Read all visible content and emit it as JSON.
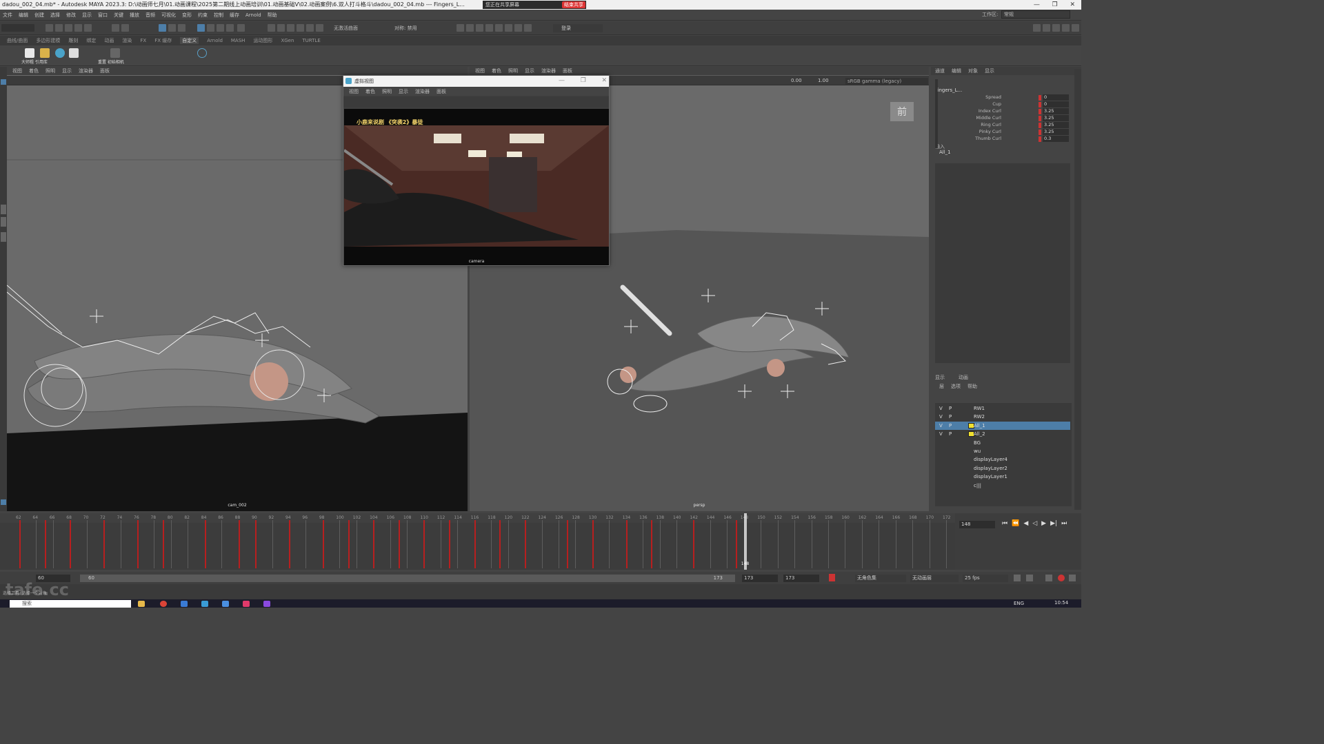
{
  "window": {
    "title": "dadou_002_04.mb* - Autodesk MAYA 2023.3: D:\\动画师七月\\01.动画课程\\2025第二期线上动画培训\\01.动画基础V\\02.动画案例\\6.双人打斗格斗\\dadou_002_04.mb  ---  Fingers_L...",
    "share_text": "您正在共享屏幕",
    "share_stop": "结束共享",
    "controls": [
      "—",
      "❐",
      "✕"
    ]
  },
  "menubar": {
    "items": [
      "文件",
      "编辑",
      "创建",
      "选择",
      "修改",
      "显示",
      "窗口",
      "关键",
      "播放",
      "音频",
      "可视化",
      "变形",
      "约束",
      "控制",
      "缓存",
      "Arnold",
      "帮助"
    ],
    "workspace_label": "工作区:",
    "workspace_value": "常规"
  },
  "statusline": {
    "symmetry": "无激活曲面",
    "symmetry_mode": "对称: 禁用",
    "login": "登录"
  },
  "shelf": {
    "tabs": [
      "曲线/曲面",
      "多边形建模",
      "雕刻",
      "绑定",
      "动画",
      "渲染",
      "FX",
      "FX 缓存",
      "自定义",
      "Arnold",
      "MASH",
      "运动图形",
      "XGen",
      "TURTLE"
    ],
    "active_tab": "自定义",
    "labels": [
      "大师粗 引用库",
      "重置 初始相机"
    ]
  },
  "viewports": {
    "menu": [
      "视图",
      "着色",
      "照明",
      "显示",
      "渲染器",
      "面板"
    ],
    "left_camera": "cam_002",
    "right_camera": "persp",
    "exposure": "0.00",
    "gamma": "1.00",
    "color_space": "sRGB gamma (legacy)",
    "view_cube": "前"
  },
  "camera_window": {
    "title": "虚拟视图",
    "menu": [
      "视图",
      "着色",
      "照明",
      "显示",
      "渲染器",
      "面板"
    ],
    "overlay": "小鹿来说剧 《突袭2》暴徒",
    "label": "camera"
  },
  "channel_box": {
    "tabs": [
      "通道",
      "编辑",
      "对象",
      "显示"
    ],
    "object": "Fingers_L...",
    "attributes": [
      {
        "label": "Spread",
        "value": "0"
      },
      {
        "label": "Cup",
        "value": "0"
      },
      {
        "label": "Index Curl",
        "value": "3.25"
      },
      {
        "label": "Middle Curl",
        "value": "3.25"
      },
      {
        "label": "Ring Curl",
        "value": "3.25"
      },
      {
        "label": "Pinky Curl",
        "value": "3.25"
      },
      {
        "label": "Thumb Curl",
        "value": "0.3"
      }
    ],
    "inputs_label": "输入",
    "input_item": "All_1"
  },
  "layer_editor": {
    "tabs": [
      "显示",
      "动画"
    ],
    "menu": [
      "层",
      "选项",
      "帮助"
    ],
    "layers": [
      {
        "v": "V",
        "p": "P",
        "color": "",
        "name": "RW1",
        "selected": false
      },
      {
        "v": "V",
        "p": "P",
        "color": "",
        "name": "RW2",
        "selected": false
      },
      {
        "v": "V",
        "p": "P",
        "color": "#f0e030",
        "name": "All_1",
        "selected": true
      },
      {
        "v": "V",
        "p": "P",
        "color": "#f0e030",
        "name": "All_2",
        "selected": false
      },
      {
        "v": "",
        "p": "",
        "color": "",
        "name": "BG",
        "selected": false
      },
      {
        "v": "",
        "p": "",
        "color": "",
        "name": "wu",
        "selected": false
      },
      {
        "v": "",
        "p": "",
        "color": "",
        "name": "displayLayer4",
        "selected": false
      },
      {
        "v": "",
        "p": "",
        "color": "",
        "name": "displayLayer2",
        "selected": false
      },
      {
        "v": "",
        "p": "",
        "color": "",
        "name": "displayLayer1",
        "selected": false
      },
      {
        "v": "",
        "p": "",
        "color": "",
        "name": "c|||",
        "selected": false
      }
    ]
  },
  "timeline": {
    "ticks": [
      "62",
      "64",
      "66",
      "68",
      "70",
      "72",
      "74",
      "76",
      "78",
      "80",
      "82",
      "84",
      "86",
      "88",
      "90",
      "92",
      "94",
      "96",
      "98",
      "100",
      "102",
      "104",
      "106",
      "108",
      "110",
      "112",
      "114",
      "116",
      "118",
      "120",
      "122",
      "124",
      "126",
      "128",
      "130",
      "132",
      "134",
      "136",
      "138",
      "140",
      "142",
      "144",
      "146",
      "148",
      "150",
      "152",
      "154",
      "156",
      "158",
      "160",
      "162",
      "164",
      "166",
      "168",
      "170",
      "172"
    ],
    "current_frame": "148",
    "key_frames": [
      62,
      65,
      68,
      72,
      76,
      79,
      84,
      88,
      90,
      94,
      98,
      101,
      104,
      107,
      110,
      113,
      116,
      119,
      122,
      127,
      130,
      134,
      137,
      142,
      147
    ],
    "keyed_color": "#b81f1f"
  },
  "range": {
    "start": "60",
    "start_inner": "60",
    "end_inner": "173",
    "end": "173",
    "end2": "173",
    "character_set": "无角色集",
    "anim_layer": "无动画层",
    "fps": "25 fps"
  },
  "cmdline": {
    "watermark": "tafe.cc",
    "hint": "选择工具: 选择一个对象"
  },
  "taskbar": {
    "search": "搜索",
    "lang": "ENG",
    "time": "10:54"
  }
}
